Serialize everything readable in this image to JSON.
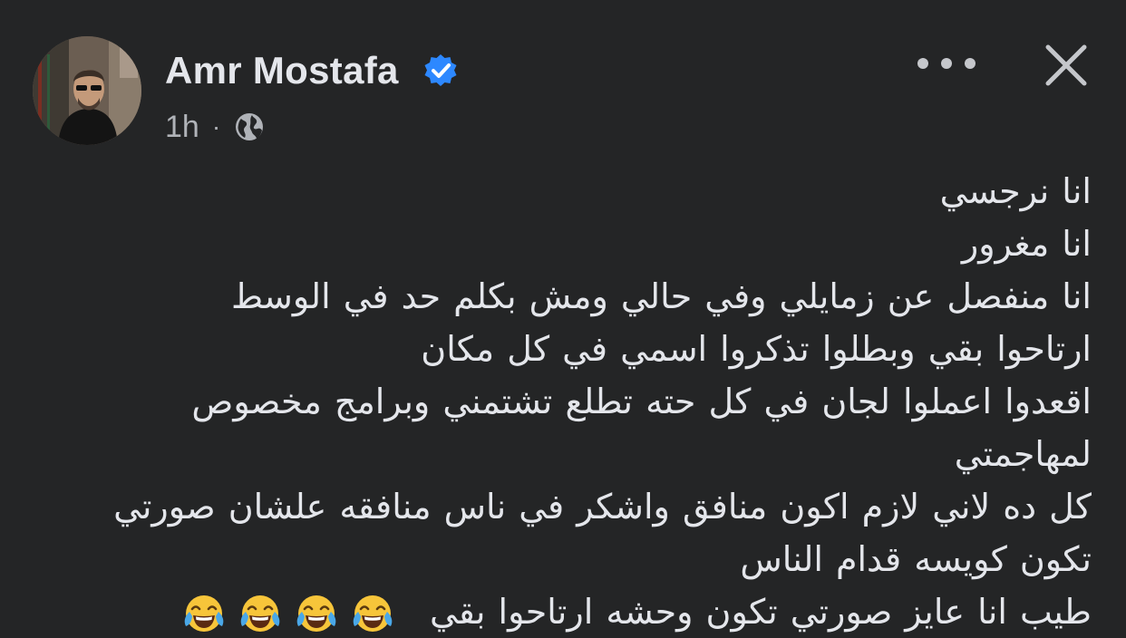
{
  "post": {
    "author": {
      "name": "Amr Mostafa",
      "verified": true,
      "avatar_icon": "profile-photo"
    },
    "meta": {
      "time": "1h",
      "separator": "·",
      "privacy_icon": "globe-icon"
    },
    "actions": {
      "more_icon": "more-options-icon",
      "close_icon": "close-icon"
    },
    "lines": [
      "انا نرجسي",
      "انا مغرور",
      "انا منفصل  عن زمايلي وفي حالي ومش بكلم حد في الوسط",
      "ارتاحوا بقي وبطلوا تذكروا اسمي في كل مكان",
      "اقعدوا اعملوا لجان في كل حته تطلع تشتمني وبرامج مخصوص",
      "لمهاجمتي",
      "كل ده لاني لازم اكون منافق واشكر في ناس منافقه علشان صورتي",
      "تكون كويسه قدام الناس",
      "طيب انا عايز صورتي تكون وحشه ارتاحوا بقي"
    ],
    "last_line_emoji": [
      "face-with-tears-of-joy",
      "face-with-tears-of-joy",
      "face-with-tears-of-joy",
      "face-with-tears-of-joy"
    ]
  },
  "colors": {
    "background": "#242526",
    "primary_text": "#e4e6eb",
    "secondary_text": "#b0b3b8",
    "verified_badge": "#2d88ff"
  }
}
